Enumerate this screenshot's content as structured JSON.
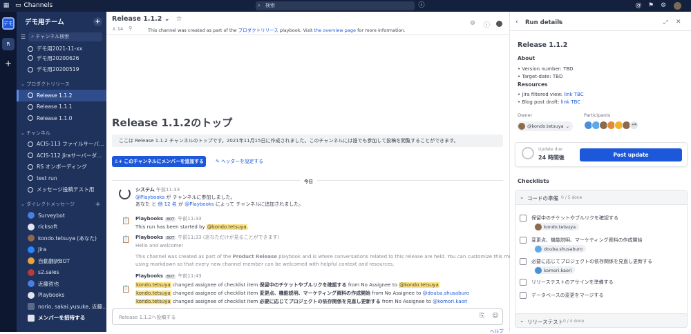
{
  "colors": {
    "topbar": "#14213e",
    "sidebar": "#1e325c",
    "accent": "#1c58d9",
    "highlight": "#ffe27a"
  },
  "topbar": {
    "app_name": "Channels",
    "search_placeholder": "検索"
  },
  "teams": [
    {
      "label": "デモ"
    },
    {
      "label": "R"
    }
  ],
  "sidebar": {
    "team_name": "デモ用チーム",
    "search_label": "チャンネル検索",
    "top_items": [
      {
        "label": "デモ用2021-11-xx"
      },
      {
        "label": "デモ用20200626"
      },
      {
        "label": "デモ用20200519"
      }
    ],
    "cat_product": "プロダクトリリース",
    "product_items": [
      {
        "label": "Release 1.1.2"
      },
      {
        "label": "Release 1.1.1"
      },
      {
        "label": "Release 1.1.0"
      }
    ],
    "cat_channels": "チャンネル",
    "channel_items": [
      {
        "label": "ACIS-113 ファイルサーバ..."
      },
      {
        "label": "ACIS-112 Jiraサーバーダ..."
      },
      {
        "label": "RS オンボーディング"
      },
      {
        "label": "test run"
      },
      {
        "label": "メッセージ投稿テスト用"
      }
    ],
    "cat_dm": "ダイレクトメッセージ",
    "dm_items": [
      {
        "label": "Surveybot"
      },
      {
        "label": "ricksoft"
      },
      {
        "label": "kondo.tetsuya (あなた)"
      },
      {
        "label": "Jira"
      },
      {
        "label": "自動翻訳BOT"
      },
      {
        "label": "s2.sales"
      },
      {
        "label": "近藤哲也"
      },
      {
        "label": "Playbooks"
      },
      {
        "label": "norio, sakai.yusuke, 近藤..."
      }
    ],
    "invite_label": "メンバーを招待する"
  },
  "channel": {
    "name": "Release 1.1.2",
    "members": "14",
    "header_text": "This channel was created as part of the ",
    "header_link": "プロダクトリリース",
    "header_text2": " playbook. Visit ",
    "header_link2": "the overview page",
    "header_text3": " for more information.",
    "intro_title": "Release 1.1.2のトップ",
    "intro_desc": "ここは Release 1.1.2 チャンネルのトップです。2021年11月15日に作成されました。このチャンネルには誰でも参加して投稿を閲覧することができます。",
    "add_members_label": "このチャンネルにメンバーを追加する",
    "set_header_label": "ヘッダーを設定する",
    "date_sep": "今日",
    "composer_placeholder": "Release 1.1.2へ投稿する",
    "help": "ヘルプ"
  },
  "posts": {
    "p1": {
      "author": "システム",
      "time": "午前11:33",
      "l1a": "@Playbooks",
      "l1b": " が チャンネルに参加しました。",
      "l2a": "あなた と ",
      "l2b": "他 12 名",
      "l2c": " が ",
      "l2d": "@Playbooks",
      "l2e": " によって チャンネルに追加されました。"
    },
    "p2": {
      "author": "Playbooks",
      "bot": "BOT",
      "time": "午前11:33",
      "text": "This run has been started by ",
      "mention": "@kondo.tetsuya",
      "end": "."
    },
    "p3": {
      "author": "Playbooks",
      "bot": "BOT",
      "time": "午前11:33 (あなただけが見ることができます)",
      "hello": "Hello and welcome!",
      "body1": "This channel was created as part of the ",
      "body_b": "Product Release",
      "body2": " playbook and is where conversations related to this release are held. You can customize this message",
      "body3": "using markdown so that every new channel member can be welcomed with helpful context and resources."
    },
    "p4": {
      "author": "Playbooks",
      "bot": "BOT",
      "time": "午前11:43",
      "rows": [
        {
          "who": "kondo.tetsuya",
          "mid": " changed assignee of checklist item ",
          "item": "保留中のチケットやブルリクを確認する",
          "from": " from No Assignee to ",
          "to": "@kondo.tetsuya"
        },
        {
          "who": "kondo.tetsuya",
          "mid": " changed assignee of checklist item ",
          "item": "変更点、機能説明、マーケティング資料の作成開始",
          "from": " from No Assignee to ",
          "to": "@douba.shusaburo"
        },
        {
          "who": "kondo.tetsuya",
          "mid": " changed assignee of checklist item ",
          "item": "必要に応じてプロジェクトの依存関係を見直し更新する",
          "from": " from No Assignee to ",
          "to": "@komori.kaori"
        }
      ]
    }
  },
  "rhs": {
    "header": "Run details",
    "run_title": "Release 1.1.2",
    "about": "About",
    "about_items": [
      {
        "label": "Version number: TBD"
      },
      {
        "label": "Target-date: TBD"
      }
    ],
    "resources": "Resources",
    "res1": "Jira filtered view: ",
    "res1_link": "link TBC",
    "res2": "Blog post draft: ",
    "res2_link": "link TBC",
    "owner_label": "Owner",
    "owner": "@kondo.tetsuya",
    "participants_label": "Participants",
    "participants_more": "+4",
    "update_due_label": "Update due",
    "update_due": "24 時間後",
    "post_update": "Post update",
    "checklists": "Checklists",
    "group1": {
      "name": "コードの準備",
      "count": "0 / 5 done"
    },
    "items": [
      {
        "label": "保留中のチケットやブルリクを確認する",
        "assignee": "kondo.tetsuya"
      },
      {
        "label": "変更点、機能説明、マーケティング資料の作成開始",
        "assignee": "douba.shusaburo"
      },
      {
        "label": "必要に応じてプロジェクトの依存関係を見直し更新する",
        "assignee": "komori.kaori"
      },
      {
        "label": "リリーステストのアサインを準備する",
        "assignee": ""
      },
      {
        "label": "データベースの変更をマージする",
        "assignee": ""
      }
    ],
    "group2": {
      "name": "リリーステスト",
      "count": "0 / 4 done"
    }
  }
}
